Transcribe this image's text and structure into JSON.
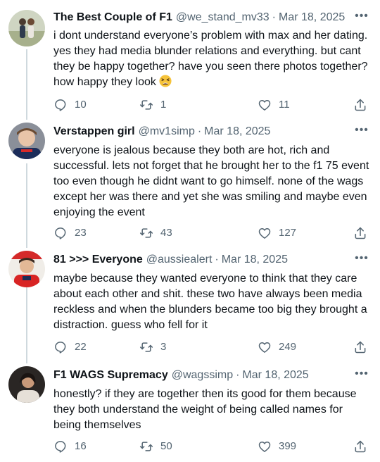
{
  "tweets": [
    {
      "display_name": "The Best Couple of F1",
      "handle": "@we_stand_mv33",
      "date": "Mar 18, 2025",
      "text": "i dont understand everyone’s problem with max and her dating. yes they had media blunder relations and everything. but cant they be happy together? have you seen there photos together? how happy they look",
      "emoji": "tired-face-emoji",
      "replies": "10",
      "retweets": "1",
      "likes": "11"
    },
    {
      "display_name": "Verstappen girl",
      "handle": "@mv1simp",
      "date": "Mar 18, 2025",
      "text": "everyone is jealous because they both are hot, rich and successful. lets not forget that he brought her to the f1 75 event too even though he didnt want to go himself. none of the wags except her was there and yet she was smiling and maybe even enjoying the event",
      "replies": "23",
      "retweets": "43",
      "likes": "127"
    },
    {
      "display_name": "81 >>> Everyone",
      "handle": "@aussiealert",
      "date": "Mar 18, 2025",
      "text": "maybe because they wanted everyone to think that they care about each other and shit. these two have always been media reckless and when the blunders became too big they brought a distraction. guess who fell for it",
      "replies": "22",
      "retweets": "3",
      "likes": "249"
    },
    {
      "display_name": "F1 WAGS Supremacy",
      "handle": "@wagssimp",
      "date": "Mar 18, 2025",
      "text": "honestly? if they are together then its good for them because they both understand the weight of being called names for being themselves",
      "replies": "16",
      "retweets": "50",
      "likes": "399"
    }
  ],
  "separator": "·",
  "more_label": "•••",
  "icons": {
    "reply": "reply-icon",
    "retweet": "retweet-icon",
    "like": "heart-icon",
    "share": "share-icon",
    "more": "more-icon"
  },
  "colors": {
    "text": "#0f1419",
    "secondary": "#536471",
    "thread_line": "#cfd9de"
  }
}
